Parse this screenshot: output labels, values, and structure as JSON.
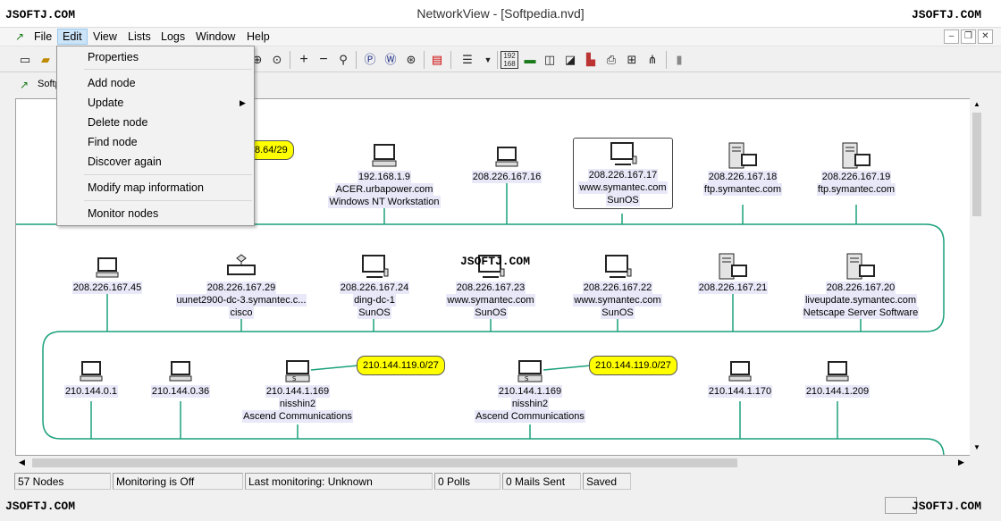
{
  "window": {
    "title": "NetworkView - [Softpedia.nvd]",
    "watermark": "JSOFTJ.COM"
  },
  "menubar": {
    "items": [
      "File",
      "Edit",
      "View",
      "Lists",
      "Logs",
      "Window",
      "Help"
    ]
  },
  "tab": {
    "label": "Softpedia"
  },
  "edit_menu": {
    "properties": "Properties",
    "add_node": "Add node",
    "update": "Update",
    "delete_node": "Delete node",
    "find_node": "Find node",
    "discover_again": "Discover again",
    "modify_map": "Modify map information",
    "monitor_nodes": "Monitor nodes"
  },
  "map": {
    "row1": [
      {
        "ip": "192.168.1.9",
        "host": "ACER.urbapower.com",
        "os": "Windows NT Workstation"
      },
      {
        "ip": "208.226.167.16"
      },
      {
        "ip": "208.226.167.17",
        "host": "www.symantec.com",
        "os": "SunOS"
      },
      {
        "ip": "208.226.167.18",
        "host": "ftp.symantec.com"
      },
      {
        "ip": "208.226.167.19",
        "host": "ftp.symantec.com"
      }
    ],
    "subnet1": "8.64/29",
    "row2": [
      {
        "ip": "208.226.167.45"
      },
      {
        "ip": "208.226.167.29",
        "host": "uunet2900-dc-3.symantec.c...",
        "os": "cisco"
      },
      {
        "ip": "208.226.167.24",
        "host": "ding-dc-1",
        "os": "SunOS"
      },
      {
        "ip": "208.226.167.23",
        "host": "www.symantec.com",
        "os": "SunOS"
      },
      {
        "ip": "208.226.167.22",
        "host": "www.symantec.com",
        "os": "SunOS"
      },
      {
        "ip": "208.226.167.21"
      },
      {
        "ip": "208.226.167.20",
        "host": "liveupdate.symantec.com",
        "os": "Netscape Server Software"
      }
    ],
    "row3": [
      {
        "ip": "210.144.0.1"
      },
      {
        "ip": "210.144.0.36"
      },
      {
        "ip": "210.144.1.169",
        "host": "nisshin2",
        "os": "Ascend Communications"
      },
      {
        "ip": "210.144.1.169",
        "host": "nisshin2",
        "os": "Ascend Communications"
      },
      {
        "ip": "210.144.1.170"
      },
      {
        "ip": "210.144.1.209"
      }
    ],
    "subnet2": "210.144.119.0/27",
    "subnet3": "210.144.119.0/27"
  },
  "statusbar": {
    "nodes": "57 Nodes",
    "monitoring": "Monitoring is Off",
    "last_monitoring": "Last monitoring: Unknown",
    "polls": "0 Polls",
    "mails": "0 Mails Sent",
    "saved": "Saved"
  },
  "colors": {
    "link": "#1aa07a",
    "subnet_fill": "#ffff00",
    "label_bg": "#e8e8f8"
  }
}
